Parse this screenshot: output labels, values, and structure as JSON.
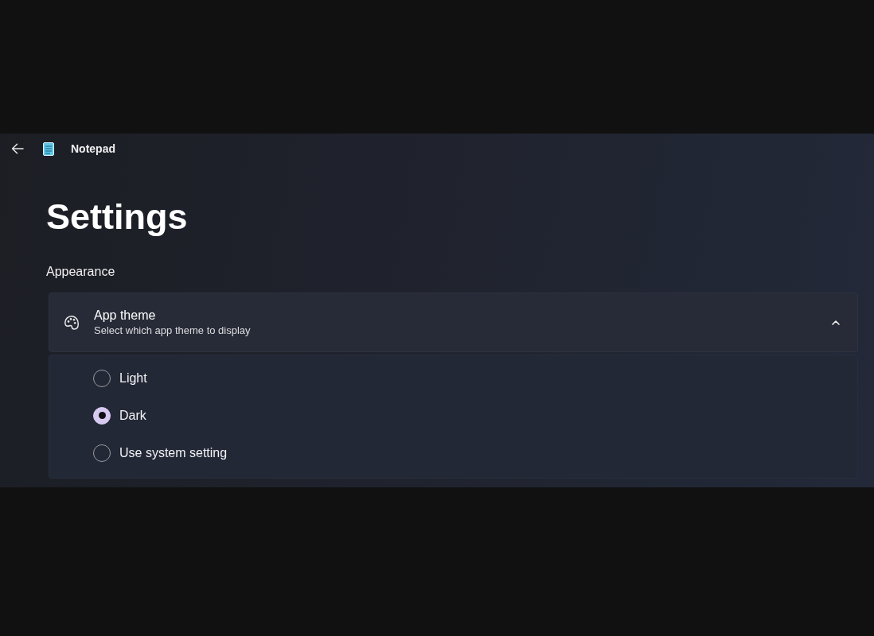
{
  "title_bar": {
    "app_name": "Notepad"
  },
  "page": {
    "title": "Settings",
    "section": "Appearance"
  },
  "app_theme": {
    "title": "App theme",
    "description": "Select which app theme to display",
    "expanded": true,
    "options": [
      {
        "label": "Light",
        "selected": false
      },
      {
        "label": "Dark",
        "selected": true
      },
      {
        "label": "Use system setting",
        "selected": false
      }
    ]
  }
}
